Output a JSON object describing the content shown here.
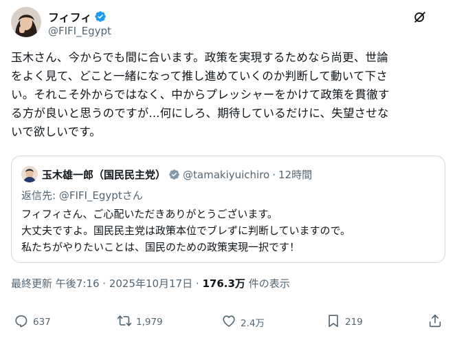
{
  "author": {
    "display_name": "フィフィ",
    "handle": "@FIFI_Egypt"
  },
  "tweet": {
    "lines": [
      "玉木さん、今からでも間に合います。政策を実現するためなら尚更、世論",
      "をよく見て、どこと一緒になって推し進めていくのか判断して動いて下さ",
      "い。それこそ外からではなく、中からプレッシャーをかけて政策を貫徹す",
      "る方が良いと思うのですが...何にしろ、期待しているだけに、失望させな",
      "いで欲しいです。"
    ]
  },
  "quote": {
    "display_name": "玉木雄一郎（国民民主党）",
    "handle": "@tamakiyuichiro",
    "separator": "·",
    "time": "12時間",
    "reply_prefix": "返信先: ",
    "reply_user": "@FIFI_Egyptさん",
    "lines": [
      "フィフィさん、ご心配いただきありがとうございます。",
      "大丈夫ですよ。国民民主党は政策本位でブレずに判断していますので。",
      "私たちがやりたいことは、国民のための政策実現一択です！"
    ]
  },
  "meta": {
    "label": "最終更新",
    "time": "午後7:16",
    "separator1": " · ",
    "date": "2025年10月17日",
    "separator2": " · ",
    "views_count": "176.3万",
    "views_label": " 件の表示"
  },
  "actions": {
    "replies": "637",
    "reposts": "1,979",
    "likes": "2.4万",
    "bookmarks": "219"
  },
  "icons": {
    "verified": "verified-badge-icon",
    "grok": "grok-icon",
    "reply": "reply-icon",
    "repost": "repost-icon",
    "like": "heart-icon",
    "bookmark": "bookmark-icon",
    "share": "share-icon"
  },
  "colors": {
    "verified_blue": "#1d9bf0",
    "secondary_text": "#536471",
    "primary_text": "#0f1419",
    "border": "#cfd9de"
  }
}
